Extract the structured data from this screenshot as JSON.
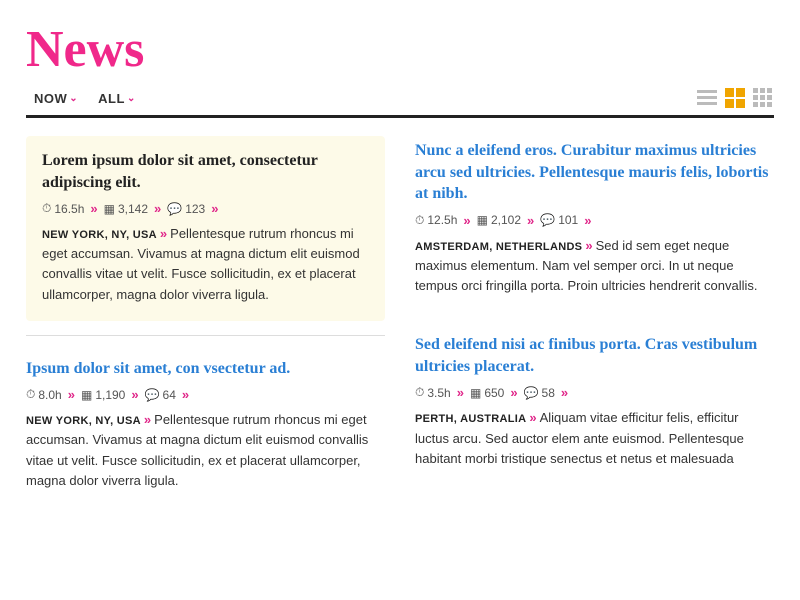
{
  "header": {
    "title": "News",
    "filters": [
      {
        "label": "NOW",
        "hasChevron": true
      },
      {
        "label": "ALL",
        "hasChevron": true
      }
    ],
    "viewIcons": [
      "lines",
      "grid4",
      "grid9"
    ]
  },
  "articles": [
    {
      "id": "featured",
      "featured": true,
      "title": "Lorem ipsum dolor sit amet, consectetur adipiscing elit.",
      "isLink": false,
      "time": "16.5h",
      "images": "3,142",
      "comments": "123",
      "location": "NEW YORK, NY, USA",
      "body": "Pellentesque rutrum rhoncus mi eget accumsan. Vivamus at magna dictum elit euismod convallis vitae ut velit. Fusce sollicitudin, ex et placerat ullamcorper, magna dolor viverra ligula."
    },
    {
      "id": "top-right",
      "featured": false,
      "title": "Nunc a eleifend eros. Curabitur maximus ultricies arcu sed ultricies. Pellentesque mauris felis, lobortis at nibh.",
      "isLink": true,
      "time": "12.5h",
      "images": "2,102",
      "comments": "101",
      "location": "AMSTERDAM, NETHERLANDS",
      "body": "Sed id sem eget neque maximus elementum. Nam vel semper orci. In ut neque tempus orci fringilla porta. Proin ultricies hendrerit convallis."
    },
    {
      "id": "bottom-left",
      "featured": false,
      "title": "Ipsum dolor sit amet, con vsectetur ad.",
      "isLink": true,
      "time": "8.0h",
      "images": "1,190",
      "comments": "64",
      "location": "NEW YORK, NY, USA",
      "body": "Pellentesque rutrum rhoncus mi eget accumsan. Vivamus at magna dictum elit euismod convallis vitae ut velit. Fusce sollicitudin, ex et placerat ullamcorper, magna dolor viverra ligula."
    },
    {
      "id": "bottom-right",
      "featured": false,
      "title": "Sed eleifend nisi ac finibus porta. Cras vestibulum ultricies placerat.",
      "isLink": true,
      "time": "3.5h",
      "images": "650",
      "comments": "58",
      "location": "PERTH, AUSTRALIA",
      "body": "Aliquam vitae efficitur felis, efficitur luctus arcu. Sed auctor elem ante euismod. Pellentesque habitant morbi tristique senectus et netus et malesuada"
    }
  ],
  "icons": {
    "clock": "⏱",
    "image": "▦",
    "comment": "💬",
    "chevron": "⌄",
    "meta_arrow": "»",
    "lines_icon": "≡",
    "grid4_icon": "⊞",
    "grid9_icon": "⊟"
  }
}
